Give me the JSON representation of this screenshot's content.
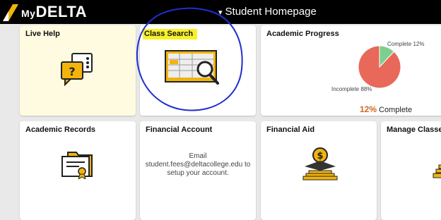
{
  "header": {
    "logo_text_my": "My",
    "logo_text_rest": "DELTA",
    "page_title": "Student Homepage",
    "caret": "▾"
  },
  "tiles": {
    "live_help": {
      "title": "Live Help",
      "icon": "chat-help-icon"
    },
    "class_search": {
      "title": "Class Search",
      "icon": "class-search-icon"
    },
    "academic_progress": {
      "title": "Academic Progress",
      "chart_data": {
        "type": "pie",
        "title": "",
        "slices": [
          {
            "label": "Complete",
            "value": 12,
            "color": "#7ccf8c"
          },
          {
            "label": "Incomplete",
            "value": 88,
            "color": "#e8695a"
          }
        ]
      },
      "complete_label": "Complete 12%",
      "incomplete_label": "Incomplete 88%",
      "summary_pct": "12%",
      "summary_text": "Complete"
    },
    "academic_records": {
      "title": "Academic Records",
      "icon": "certificate-icon"
    },
    "financial_account": {
      "title": "Financial Account",
      "email_line1": "Email",
      "email_line2": "student.fees@deltacollege.edu to",
      "email_line3": "setup your account."
    },
    "financial_aid": {
      "title": "Financial Aid",
      "icon": "financial-aid-icon"
    },
    "manage_classes": {
      "title": "Manage Classes",
      "icon": "manage-classes-icon"
    }
  },
  "colors": {
    "topbar": "#000000",
    "accent_orange": "#d2691e",
    "gold": "#f2b40c",
    "highlight": "#f8f02a",
    "annotation": "#1f2fd0"
  }
}
